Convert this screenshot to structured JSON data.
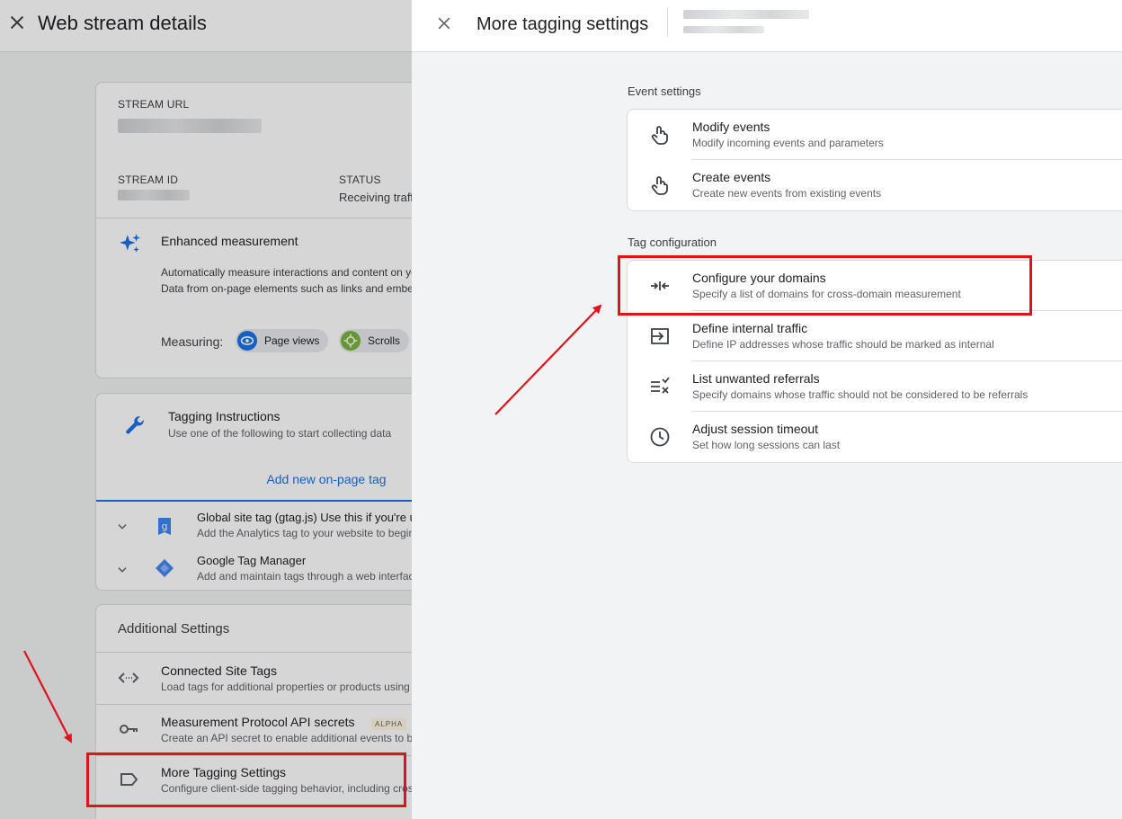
{
  "left": {
    "title": "Web stream details",
    "stream": {
      "url_label": "STREAM URL",
      "id_label": "STREAM ID",
      "status_label": "STATUS",
      "status_value": "Receiving traffic"
    },
    "enhanced": {
      "title": "Enhanced measurement",
      "line1": "Automatically measure interactions and content on your sites in addition to standard page view measurement.",
      "line2": "Data from on-page elements such as links and embedded videos may be collected with relevant events.",
      "measuring_label": "Measuring:",
      "chips": [
        "Page views",
        "Scrolls"
      ]
    },
    "tagging": {
      "title": "Tagging Instructions",
      "subtitle": "Use one of the following to start collecting data",
      "add_tag": "Add new on-page tag",
      "rows": [
        {
          "title": "Global site tag (gtag.js) Use this if you're using a website builder",
          "sub": "Add the Analytics tag to your website to begin seeing data"
        },
        {
          "title": "Google Tag Manager",
          "sub": "Add and maintain tags through a web interface"
        }
      ]
    },
    "additional": {
      "title": "Additional Settings",
      "items": [
        {
          "title": "Connected Site Tags",
          "sub": "Load tags for additional properties or products using this stream's on-page tag"
        },
        {
          "title": "Measurement Protocol API secrets",
          "sub": "Create an API secret to enable additional events to be sent",
          "badge": "ALPHA"
        },
        {
          "title": "More Tagging Settings",
          "sub": "Configure client-side tagging behavior, including cross-domain linking"
        }
      ]
    }
  },
  "panel": {
    "title": "More tagging settings",
    "sections": [
      {
        "label": "Event settings",
        "items": [
          {
            "title": "Modify events",
            "sub": "Modify incoming events and parameters",
            "icon": "touch-icon"
          },
          {
            "title": "Create events",
            "sub": "Create new events from existing events",
            "icon": "touch-icon"
          }
        ]
      },
      {
        "label": "Tag configuration",
        "items": [
          {
            "title": "Configure your domains",
            "sub": "Specify a list of domains for cross-domain measurement",
            "icon": "merge-arrows-icon"
          },
          {
            "title": "Define internal traffic",
            "sub": "Define IP addresses whose traffic should be marked as internal",
            "icon": "login-arrow-icon"
          },
          {
            "title": "List unwanted referrals",
            "sub": "Specify domains whose traffic should not be considered to be referrals",
            "icon": "list-remove-icon"
          },
          {
            "title": "Adjust session timeout",
            "sub": "Set how long sessions can last",
            "icon": "clock-icon"
          }
        ]
      }
    ]
  },
  "colors": {
    "accent": "#1a73e8",
    "highlight": "#e0131b"
  }
}
